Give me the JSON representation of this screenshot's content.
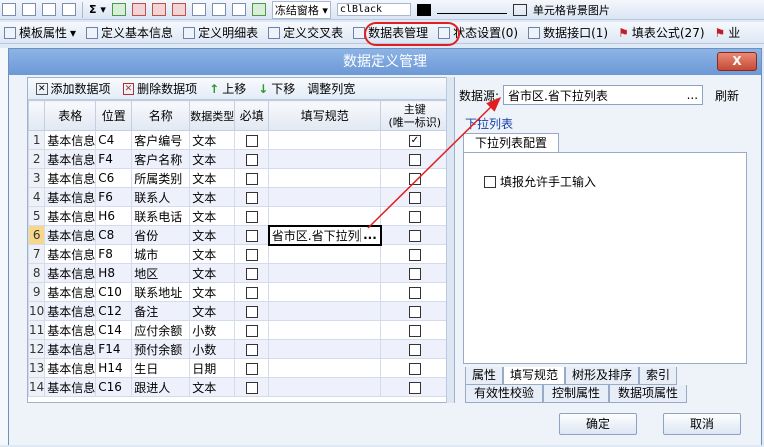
{
  "toolbar_top": {
    "freeze_label": "冻结窗格",
    "font_color_label": "clBlack",
    "cell_bg_label": "单元格背景图片"
  },
  "toolbar_second": {
    "items": [
      {
        "label": "模板属性"
      },
      {
        "label": "定义基本信息"
      },
      {
        "label": "定义明细表"
      },
      {
        "label": "定义交叉表"
      },
      {
        "label": "数据表管理"
      },
      {
        "label": "状态设置(0)"
      },
      {
        "label": "数据接口(1)"
      },
      {
        "label": "填表公式(27)"
      },
      {
        "label": "业"
      }
    ]
  },
  "dialog": {
    "title": "数据定义管理",
    "close_label": "X",
    "left_toolbar": {
      "add": "添加数据项",
      "delete": "删除数据项",
      "up": "上移",
      "down": "下移",
      "adjust": "调整列宽"
    },
    "columns": [
      "表格",
      "位置",
      "名称",
      "数据类型",
      "必填",
      "填写规范",
      "主键\n(唯一标识)"
    ],
    "rows": [
      {
        "n": "1",
        "table": "基本信息",
        "pos": "C4",
        "name": "客户编号",
        "type": "文本",
        "req": false,
        "rule": "",
        "key": true
      },
      {
        "n": "2",
        "table": "基本信息",
        "pos": "F4",
        "name": "客户名称",
        "type": "文本",
        "req": false,
        "rule": "",
        "key": false
      },
      {
        "n": "3",
        "table": "基本信息",
        "pos": "C6",
        "name": "所属类别",
        "type": "文本",
        "req": false,
        "rule": "",
        "key": false
      },
      {
        "n": "4",
        "table": "基本信息",
        "pos": "F6",
        "name": "联系人",
        "type": "文本",
        "req": false,
        "rule": "",
        "key": false
      },
      {
        "n": "5",
        "table": "基本信息",
        "pos": "H6",
        "name": "联系电话",
        "type": "文本",
        "req": false,
        "rule": "",
        "key": false
      },
      {
        "n": "6",
        "table": "基本信息",
        "pos": "C8",
        "name": "省份",
        "type": "文本",
        "req": false,
        "rule": "省市区.省下拉列表",
        "key": false
      },
      {
        "n": "7",
        "table": "基本信息",
        "pos": "F8",
        "name": "城市",
        "type": "文本",
        "req": false,
        "rule": "",
        "key": false
      },
      {
        "n": "8",
        "table": "基本信息",
        "pos": "H8",
        "name": "地区",
        "type": "文本",
        "req": false,
        "rule": "",
        "key": false
      },
      {
        "n": "9",
        "table": "基本信息",
        "pos": "C10",
        "name": "联系地址",
        "type": "文本",
        "req": false,
        "rule": "",
        "key": false
      },
      {
        "n": "10",
        "table": "基本信息",
        "pos": "C12",
        "name": "备注",
        "type": "文本",
        "req": false,
        "rule": "",
        "key": false
      },
      {
        "n": "11",
        "table": "基本信息",
        "pos": "C14",
        "name": "应付余额",
        "type": "小数",
        "req": false,
        "rule": "",
        "key": false
      },
      {
        "n": "12",
        "table": "基本信息",
        "pos": "F14",
        "name": "预付余额",
        "type": "小数",
        "req": false,
        "rule": "",
        "key": false
      },
      {
        "n": "13",
        "table": "基本信息",
        "pos": "H14",
        "name": "生日",
        "type": "日期",
        "req": false,
        "rule": "",
        "key": false
      },
      {
        "n": "14",
        "table": "基本信息",
        "pos": "C16",
        "name": "跟进人",
        "type": "文本",
        "req": false,
        "rule": "",
        "key": false
      }
    ],
    "right": {
      "datasource_label": "数据源:",
      "datasource_value": "省市区.省下拉列表",
      "ellipsis": "...",
      "refresh": "刷新",
      "dropdown_link": "下拉列表",
      "config_tab": "下拉列表配置",
      "allow_manual": "填报允许手工输入",
      "tabs_row1": [
        "属性",
        "填写规范",
        "树形及排序",
        "索引"
      ],
      "tabs_row2": [
        "有效性校验",
        "控制属性",
        "数据项属性"
      ]
    },
    "ok": "确定",
    "cancel": "取消"
  },
  "colors": {
    "title_bar": "#7aa6dd",
    "highlight": "#e02020",
    "link": "#1a3fa8"
  }
}
